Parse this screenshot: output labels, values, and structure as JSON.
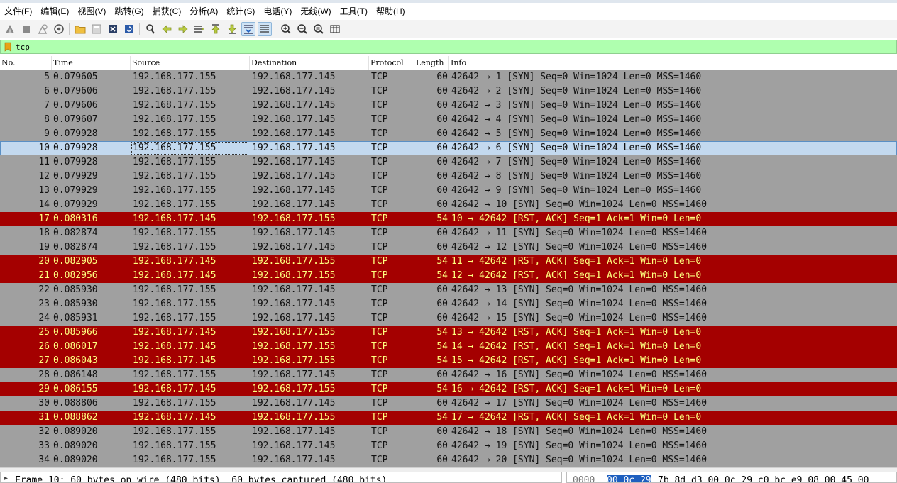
{
  "menu": [
    "文件(F)",
    "编辑(E)",
    "视图(V)",
    "跳转(G)",
    "捕获(C)",
    "分析(A)",
    "统计(S)",
    "电话(Y)",
    "无线(W)",
    "工具(T)",
    "帮助(H)"
  ],
  "toolbar_icons": [
    "start-capture-icon",
    "stop-capture-icon",
    "restart-capture-icon",
    "capture-options-icon",
    "open-file-icon",
    "save-file-icon",
    "close-file-icon",
    "reload-file-icon",
    "find-packet-icon",
    "go-back-icon",
    "go-forward-icon",
    "go-to-packet-icon",
    "go-first-icon",
    "go-last-icon",
    "autoscroll-icon",
    "colorize-icon",
    "zoom-in-icon",
    "zoom-out-icon",
    "zoom-normal-icon",
    "resize-columns-icon"
  ],
  "filter": {
    "value": "tcp"
  },
  "columns": {
    "no": "No.",
    "time": "Time",
    "source": "Source",
    "destination": "Destination",
    "protocol": "Protocol",
    "length": "Length",
    "info": "Info"
  },
  "packets": [
    {
      "no": "5",
      "time": "0.079605",
      "src": "192.168.177.155",
      "dst": "192.168.177.145",
      "proto": "TCP",
      "len": "60",
      "info": "42642 → 1 [SYN] Seq=0 Win=1024 Len=0 MSS=1460",
      "type": "syn"
    },
    {
      "no": "6",
      "time": "0.079606",
      "src": "192.168.177.155",
      "dst": "192.168.177.145",
      "proto": "TCP",
      "len": "60",
      "info": "42642 → 2 [SYN] Seq=0 Win=1024 Len=0 MSS=1460",
      "type": "syn"
    },
    {
      "no": "7",
      "time": "0.079606",
      "src": "192.168.177.155",
      "dst": "192.168.177.145",
      "proto": "TCP",
      "len": "60",
      "info": "42642 → 3 [SYN] Seq=0 Win=1024 Len=0 MSS=1460",
      "type": "syn"
    },
    {
      "no": "8",
      "time": "0.079607",
      "src": "192.168.177.155",
      "dst": "192.168.177.145",
      "proto": "TCP",
      "len": "60",
      "info": "42642 → 4 [SYN] Seq=0 Win=1024 Len=0 MSS=1460",
      "type": "syn"
    },
    {
      "no": "9",
      "time": "0.079928",
      "src": "192.168.177.155",
      "dst": "192.168.177.145",
      "proto": "TCP",
      "len": "60",
      "info": "42642 → 5 [SYN] Seq=0 Win=1024 Len=0 MSS=1460",
      "type": "syn"
    },
    {
      "no": "10",
      "time": "0.079928",
      "src": "192.168.177.155",
      "dst": "192.168.177.145",
      "proto": "TCP",
      "len": "60",
      "info": "42642 → 6 [SYN] Seq=0 Win=1024 Len=0 MSS=1460",
      "type": "sel"
    },
    {
      "no": "11",
      "time": "0.079928",
      "src": "192.168.177.155",
      "dst": "192.168.177.145",
      "proto": "TCP",
      "len": "60",
      "info": "42642 → 7 [SYN] Seq=0 Win=1024 Len=0 MSS=1460",
      "type": "syn"
    },
    {
      "no": "12",
      "time": "0.079929",
      "src": "192.168.177.155",
      "dst": "192.168.177.145",
      "proto": "TCP",
      "len": "60",
      "info": "42642 → 8 [SYN] Seq=0 Win=1024 Len=0 MSS=1460",
      "type": "syn"
    },
    {
      "no": "13",
      "time": "0.079929",
      "src": "192.168.177.155",
      "dst": "192.168.177.145",
      "proto": "TCP",
      "len": "60",
      "info": "42642 → 9 [SYN] Seq=0 Win=1024 Len=0 MSS=1460",
      "type": "syn"
    },
    {
      "no": "14",
      "time": "0.079929",
      "src": "192.168.177.155",
      "dst": "192.168.177.145",
      "proto": "TCP",
      "len": "60",
      "info": "42642 → 10 [SYN] Seq=0 Win=1024 Len=0 MSS=1460",
      "type": "syn"
    },
    {
      "no": "17",
      "time": "0.080316",
      "src": "192.168.177.145",
      "dst": "192.168.177.155",
      "proto": "TCP",
      "len": "54",
      "info": "10 → 42642 [RST, ACK] Seq=1 Ack=1 Win=0 Len=0",
      "type": "rst"
    },
    {
      "no": "18",
      "time": "0.082874",
      "src": "192.168.177.155",
      "dst": "192.168.177.145",
      "proto": "TCP",
      "len": "60",
      "info": "42642 → 11 [SYN] Seq=0 Win=1024 Len=0 MSS=1460",
      "type": "syn"
    },
    {
      "no": "19",
      "time": "0.082874",
      "src": "192.168.177.155",
      "dst": "192.168.177.145",
      "proto": "TCP",
      "len": "60",
      "info": "42642 → 12 [SYN] Seq=0 Win=1024 Len=0 MSS=1460",
      "type": "syn"
    },
    {
      "no": "20",
      "time": "0.082905",
      "src": "192.168.177.145",
      "dst": "192.168.177.155",
      "proto": "TCP",
      "len": "54",
      "info": "11 → 42642 [RST, ACK] Seq=1 Ack=1 Win=0 Len=0",
      "type": "rst"
    },
    {
      "no": "21",
      "time": "0.082956",
      "src": "192.168.177.145",
      "dst": "192.168.177.155",
      "proto": "TCP",
      "len": "54",
      "info": "12 → 42642 [RST, ACK] Seq=1 Ack=1 Win=0 Len=0",
      "type": "rst"
    },
    {
      "no": "22",
      "time": "0.085930",
      "src": "192.168.177.155",
      "dst": "192.168.177.145",
      "proto": "TCP",
      "len": "60",
      "info": "42642 → 13 [SYN] Seq=0 Win=1024 Len=0 MSS=1460",
      "type": "syn"
    },
    {
      "no": "23",
      "time": "0.085930",
      "src": "192.168.177.155",
      "dst": "192.168.177.145",
      "proto": "TCP",
      "len": "60",
      "info": "42642 → 14 [SYN] Seq=0 Win=1024 Len=0 MSS=1460",
      "type": "syn"
    },
    {
      "no": "24",
      "time": "0.085931",
      "src": "192.168.177.155",
      "dst": "192.168.177.145",
      "proto": "TCP",
      "len": "60",
      "info": "42642 → 15 [SYN] Seq=0 Win=1024 Len=0 MSS=1460",
      "type": "syn"
    },
    {
      "no": "25",
      "time": "0.085966",
      "src": "192.168.177.145",
      "dst": "192.168.177.155",
      "proto": "TCP",
      "len": "54",
      "info": "13 → 42642 [RST, ACK] Seq=1 Ack=1 Win=0 Len=0",
      "type": "rst"
    },
    {
      "no": "26",
      "time": "0.086017",
      "src": "192.168.177.145",
      "dst": "192.168.177.155",
      "proto": "TCP",
      "len": "54",
      "info": "14 → 42642 [RST, ACK] Seq=1 Ack=1 Win=0 Len=0",
      "type": "rst"
    },
    {
      "no": "27",
      "time": "0.086043",
      "src": "192.168.177.145",
      "dst": "192.168.177.155",
      "proto": "TCP",
      "len": "54",
      "info": "15 → 42642 [RST, ACK] Seq=1 Ack=1 Win=0 Len=0",
      "type": "rst"
    },
    {
      "no": "28",
      "time": "0.086148",
      "src": "192.168.177.155",
      "dst": "192.168.177.145",
      "proto": "TCP",
      "len": "60",
      "info": "42642 → 16 [SYN] Seq=0 Win=1024 Len=0 MSS=1460",
      "type": "syn"
    },
    {
      "no": "29",
      "time": "0.086155",
      "src": "192.168.177.145",
      "dst": "192.168.177.155",
      "proto": "TCP",
      "len": "54",
      "info": "16 → 42642 [RST, ACK] Seq=1 Ack=1 Win=0 Len=0",
      "type": "rst"
    },
    {
      "no": "30",
      "time": "0.088806",
      "src": "192.168.177.155",
      "dst": "192.168.177.145",
      "proto": "TCP",
      "len": "60",
      "info": "42642 → 17 [SYN] Seq=0 Win=1024 Len=0 MSS=1460",
      "type": "syn"
    },
    {
      "no": "31",
      "time": "0.088862",
      "src": "192.168.177.145",
      "dst": "192.168.177.155",
      "proto": "TCP",
      "len": "54",
      "info": "17 → 42642 [RST, ACK] Seq=1 Ack=1 Win=0 Len=0",
      "type": "rst"
    },
    {
      "no": "32",
      "time": "0.089020",
      "src": "192.168.177.155",
      "dst": "192.168.177.145",
      "proto": "TCP",
      "len": "60",
      "info": "42642 → 18 [SYN] Seq=0 Win=1024 Len=0 MSS=1460",
      "type": "syn"
    },
    {
      "no": "33",
      "time": "0.089020",
      "src": "192.168.177.155",
      "dst": "192.168.177.145",
      "proto": "TCP",
      "len": "60",
      "info": "42642 → 19 [SYN] Seq=0 Win=1024 Len=0 MSS=1460",
      "type": "syn"
    },
    {
      "no": "34",
      "time": "0.089020",
      "src": "192.168.177.155",
      "dst": "192.168.177.145",
      "proto": "TCP",
      "len": "60",
      "info": "42642 → 20 [SYN] Seq=0 Win=1024 Len=0 MSS=1460",
      "type": "syn"
    }
  ],
  "details": {
    "frame_summary": "Frame 10: 60 bytes on wire (480 bits), 60 bytes captured (480 bits)"
  },
  "bytes": {
    "offset": "0000",
    "highlighted": "00 0c 29",
    "rest": "7b 8d d3 00 0c  29 c0 bc e9 08 00 45 00"
  },
  "colors": {
    "syn_row": "#a0a0a0",
    "rst_row": "#a40000",
    "rst_text": "#ffff7f",
    "selected_row": "#c3d9ef",
    "filter_valid": "#afffaf"
  }
}
